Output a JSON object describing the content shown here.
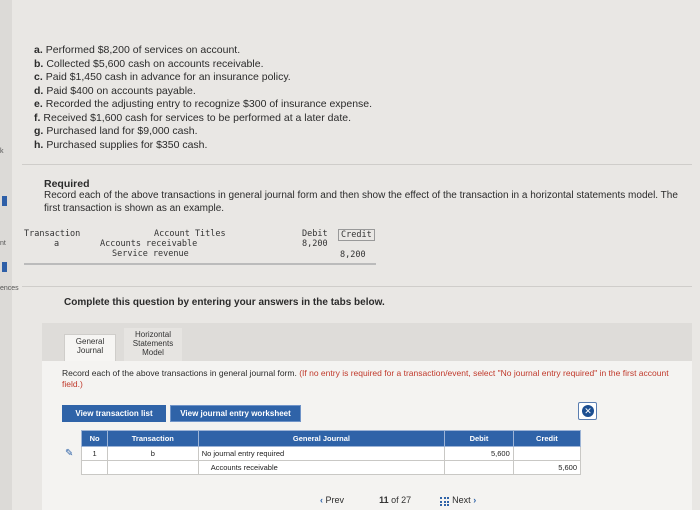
{
  "sidebar": {
    "marks": [
      "k",
      "nt",
      "ences"
    ]
  },
  "transactions": [
    {
      "letter": "a.",
      "text": "Performed $8,200 of services on account."
    },
    {
      "letter": "b.",
      "text": "Collected $5,600 cash on accounts receivable."
    },
    {
      "letter": "c.",
      "text": "Paid $1,450 cash in advance for an insurance policy."
    },
    {
      "letter": "d.",
      "text": "Paid $400 on accounts payable."
    },
    {
      "letter": "e.",
      "text": "Recorded the adjusting entry to recognize $300 of insurance expense."
    },
    {
      "letter": "f.",
      "text": "Received $1,600 cash for services to be performed at a later date."
    },
    {
      "letter": "g.",
      "text": "Purchased land for $9,000 cash."
    },
    {
      "letter": "h.",
      "text": "Purchased supplies for $350 cash."
    }
  ],
  "required": {
    "heading": "Required",
    "text": "Record each of the above transactions in general journal form and then show the effect of the transaction in a horizontal statements model. The first transaction is shown as an example."
  },
  "example": {
    "headers": {
      "transaction": "Transaction",
      "titles": "Account Titles",
      "debit": "Debit",
      "credit": "Credit"
    },
    "row1": {
      "transaction": "a",
      "account": "Accounts receivable",
      "debit": "8,200"
    },
    "row2": {
      "account": "Service revenue",
      "credit": "8,200"
    }
  },
  "complete_prompt": "Complete this question by entering your answers in the tabs below.",
  "tabs": {
    "general": "General Journal",
    "horizontal": "Horizontal Statements Model"
  },
  "instructions": {
    "main": "Record each of the above transactions in general journal form. ",
    "note": "(If no entry is required for a transaction/event, select \"No journal entry required\" in the first account field.)"
  },
  "buttons": {
    "view_list": "View transaction list",
    "view_worksheet": "View journal entry worksheet"
  },
  "journal": {
    "headers": {
      "no": "No",
      "transaction": "Transaction",
      "general": "General Journal",
      "debit": "Debit",
      "credit": "Credit"
    },
    "row1": {
      "no": "1",
      "transaction": "b",
      "account": "No journal entry required",
      "debit": "5,600",
      "credit": ""
    },
    "row2": {
      "no": "",
      "transaction": "",
      "account": "Accounts receivable",
      "debit": "",
      "credit": "5,600"
    }
  },
  "pager": {
    "prev": "Prev",
    "current": "11",
    "of": "of",
    "total": "27",
    "next": "Next"
  }
}
